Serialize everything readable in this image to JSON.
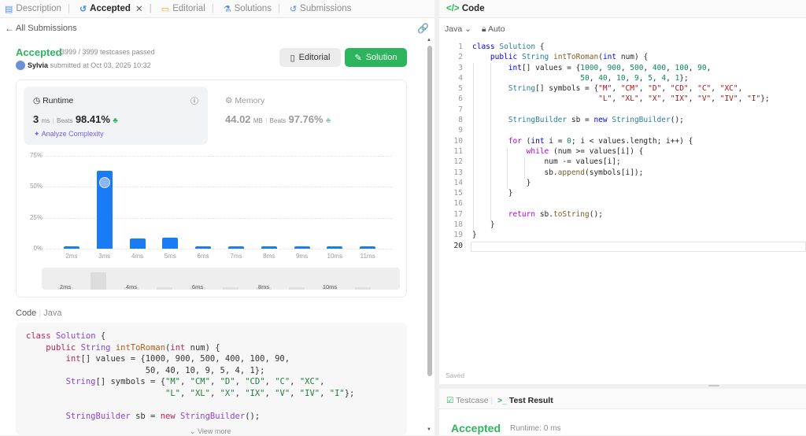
{
  "tabs": [
    {
      "label": "Description",
      "icon": "description-icon"
    },
    {
      "label": "Accepted",
      "icon": "history-icon"
    },
    {
      "label": "Editorial",
      "icon": "book-icon"
    },
    {
      "label": "Solutions",
      "icon": "flask-icon"
    },
    {
      "label": "Submissions",
      "icon": "history-icon"
    }
  ],
  "nav": {
    "back_label": "All Submissions"
  },
  "submission": {
    "status": "Accepted",
    "testcases": "3999 / 3999 testcases passed",
    "user": "Sylvia",
    "submitted": "submitted at Oct 03, 2025 10:32",
    "editorial_btn": "Editorial",
    "solution_btn": "Solution"
  },
  "runtime": {
    "label": "Runtime",
    "value": "3",
    "unit": "ms",
    "beats_label": "Beats",
    "beats": "98.41%",
    "analyze": "Analyze Complexity"
  },
  "memory": {
    "label": "Memory",
    "value": "44.02",
    "unit": "MB",
    "beats_label": "Beats",
    "beats": "97.76%"
  },
  "chart_data": {
    "type": "bar",
    "categories": [
      "2ms",
      "3ms",
      "4ms",
      "5ms",
      "6ms",
      "7ms",
      "8ms",
      "9ms",
      "10ms",
      "11ms"
    ],
    "values": [
      2,
      63,
      8,
      9,
      2,
      2,
      2,
      2,
      2,
      2
    ],
    "ylim": [
      0,
      75
    ],
    "yticks": [
      "75%",
      "50%",
      "25%",
      "0%"
    ],
    "brush_ticks": [
      "2ms",
      "4ms",
      "6ms",
      "8ms",
      "10ms"
    ],
    "highlight": "3ms",
    "bar_color": "#1a7cf5"
  },
  "code_section": {
    "label": "Code",
    "lang": "Java",
    "view_more": "View more"
  },
  "editor": {
    "title": "Code",
    "language": "Java",
    "mode": "Auto",
    "saved": "Saved",
    "lines": [
      "class Solution {",
      "    public String intToRoman(int num) {",
      "        int[] values = {1000, 900, 500, 400, 100, 90,",
      "                        50, 40, 10, 9, 5, 4, 1};",
      "        String[] symbols = {\"M\", \"CM\", \"D\", \"CD\", \"C\", \"XC\",",
      "                            \"L\", \"XL\", \"X\", \"IX\", \"V\", \"IV\", \"I\"};",
      "",
      "        StringBuilder sb = new StringBuilder();",
      "",
      "        for (int i = 0; i < values.length; i++) {",
      "            while (num >= values[i]) {",
      "                num -= values[i];",
      "                sb.append(symbols[i]);",
      "            }",
      "        }",
      "",
      "        return sb.toString();",
      "    }",
      "}",
      ""
    ]
  },
  "bottom": {
    "testcase_tab": "Testcase",
    "result_tab": "Test Result",
    "status": "Accepted",
    "runtime": "Runtime: 0 ms"
  }
}
